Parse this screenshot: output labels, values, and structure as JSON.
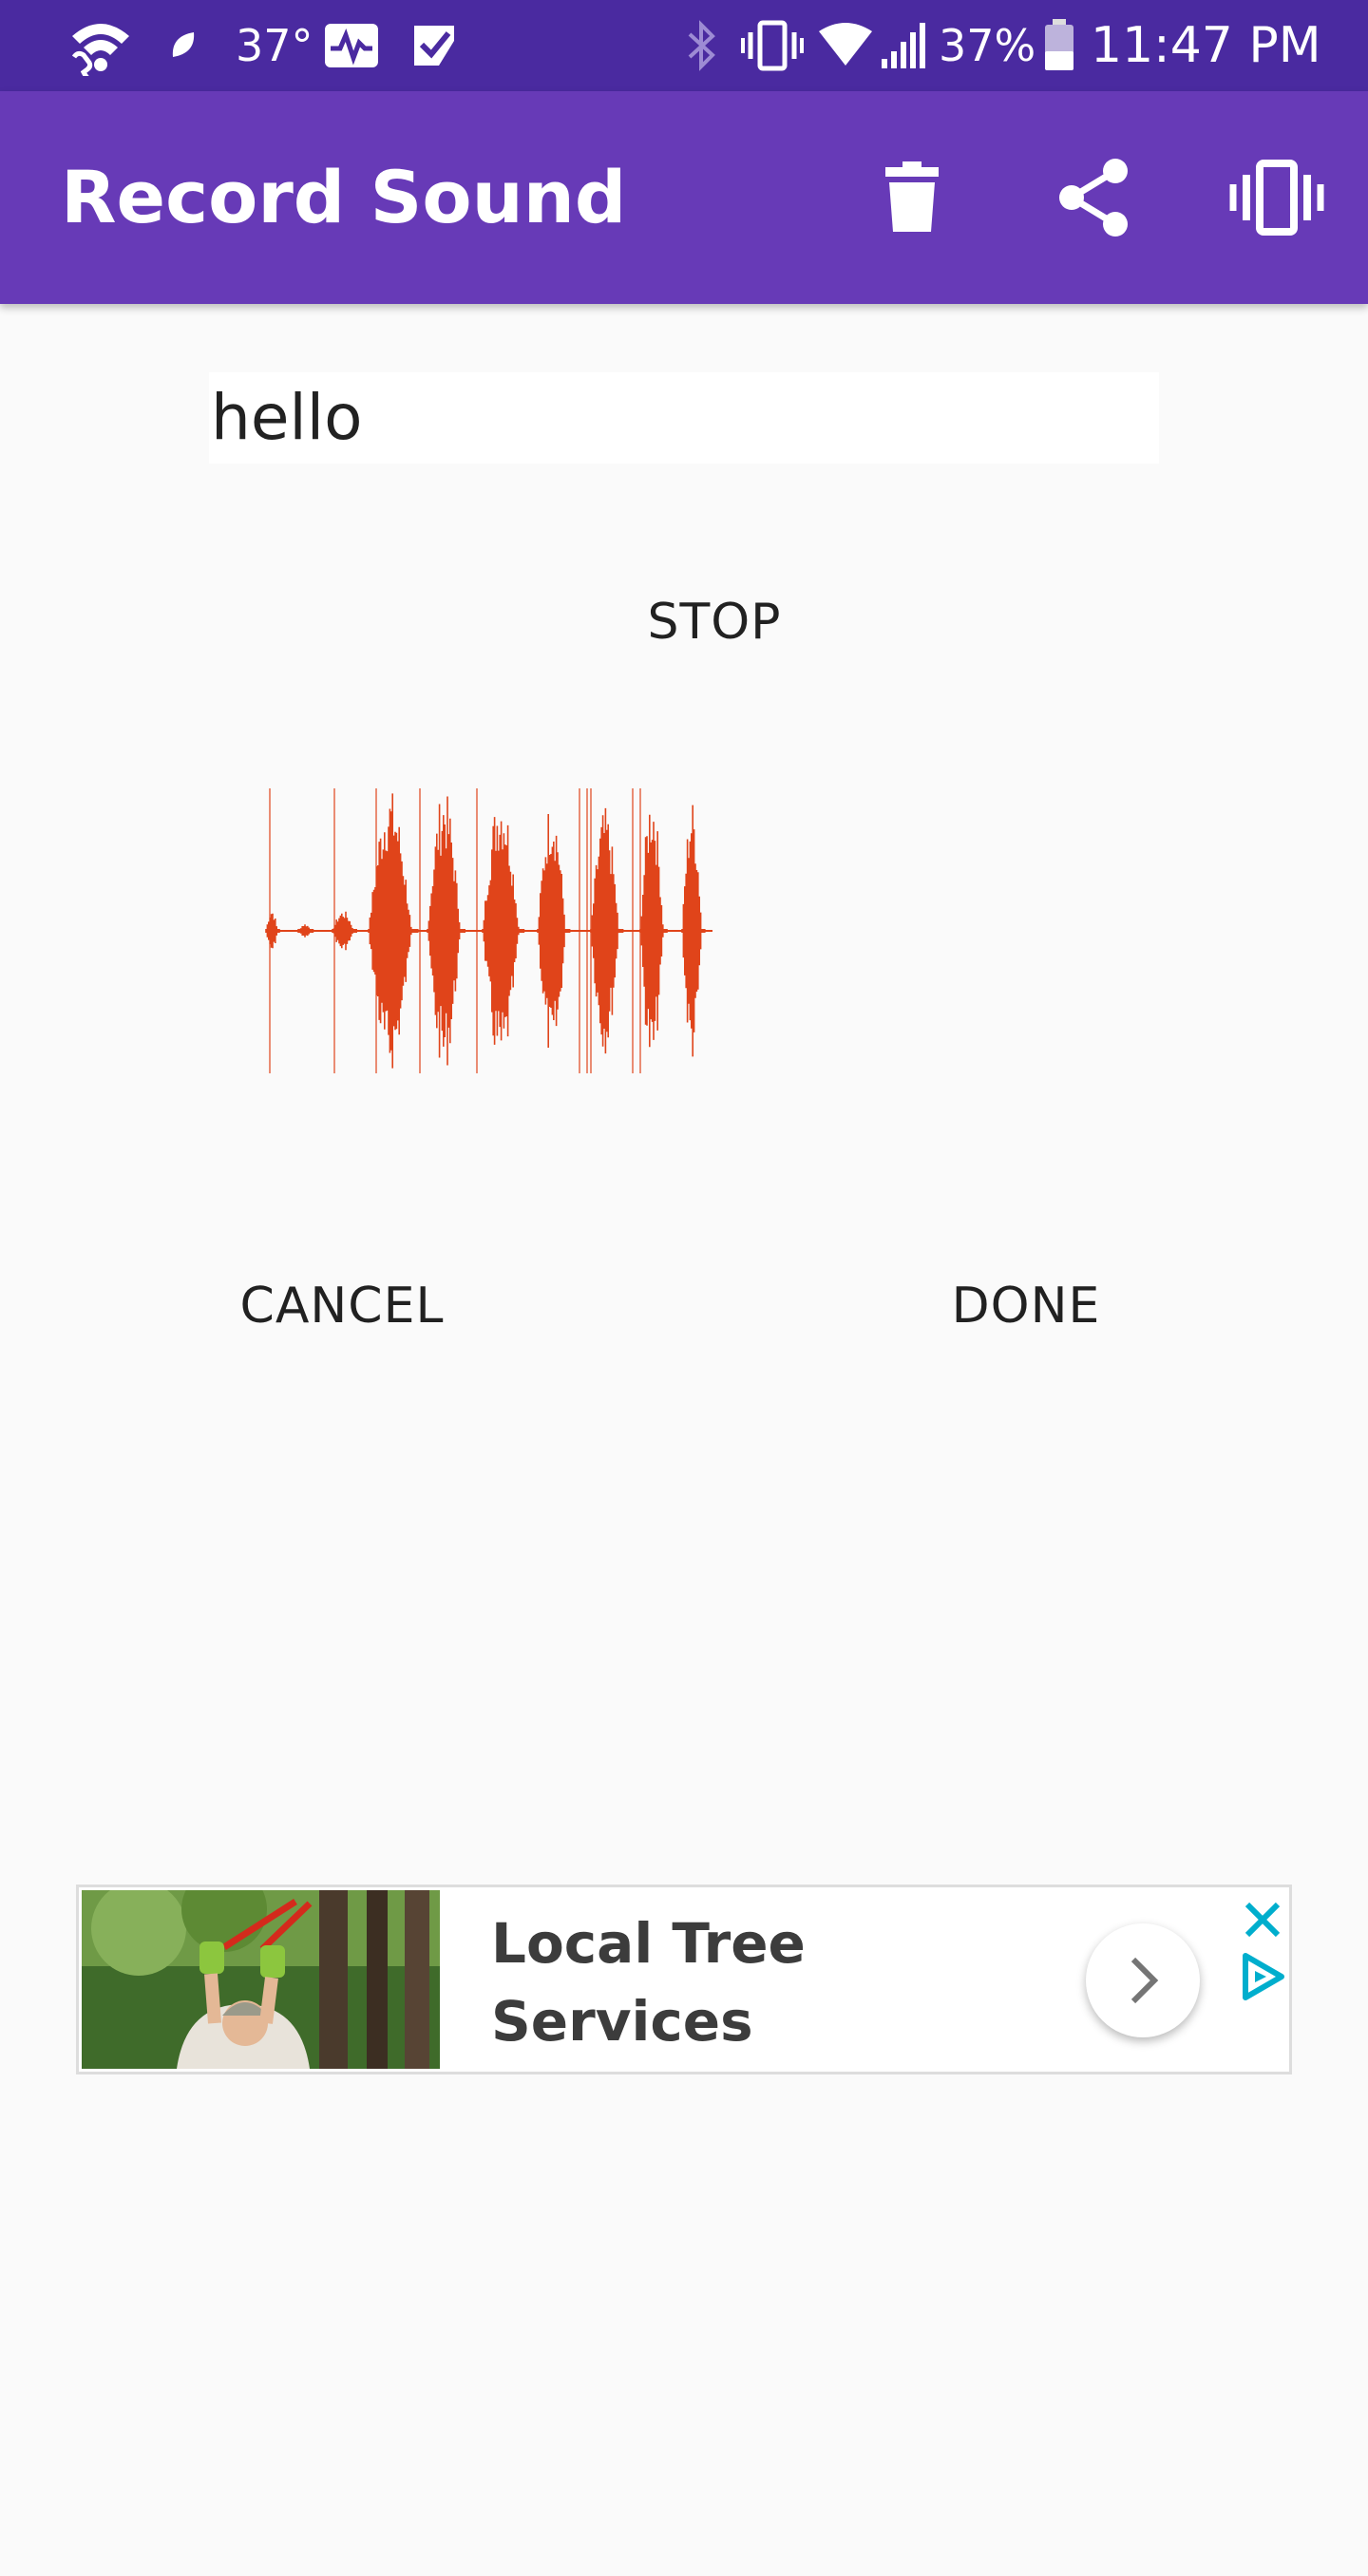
{
  "status_bar": {
    "temperature": "37°",
    "battery_percent": "37%",
    "time": "11:47 PM",
    "icons": [
      "wifi-calling-icon",
      "leaf-icon",
      "health-monitor-icon",
      "task-check-icon",
      "bluetooth-icon",
      "vibrate-icon",
      "wifi-signal-icon",
      "cell-signal-icon",
      "battery-icon"
    ]
  },
  "app_bar": {
    "title": "Record Sound",
    "background": "#673ab7",
    "actions": [
      "delete-icon",
      "share-icon",
      "vibrate-icon"
    ]
  },
  "recording": {
    "name_value": "hello",
    "stop_label": "STOP",
    "waveform_color": "#e0441a"
  },
  "actions": {
    "cancel_label": "CANCEL",
    "done_label": "DONE"
  },
  "ad": {
    "title_line1": "Local Tree",
    "title_line2": "Services",
    "accent_color": "#00aecd"
  }
}
